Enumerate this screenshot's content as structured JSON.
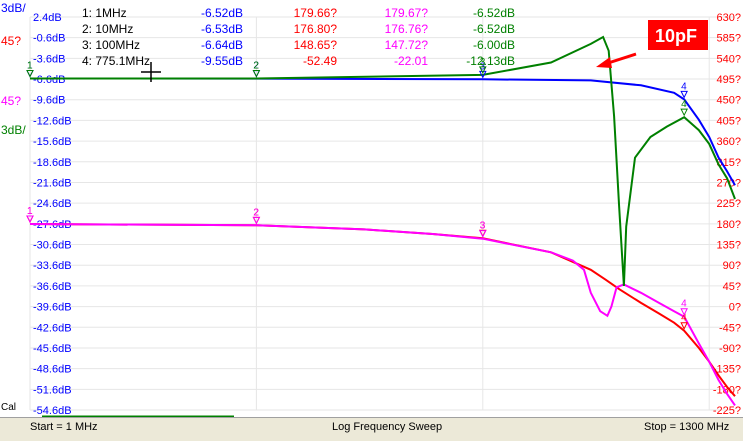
{
  "colors": {
    "trace_s21_mag": "#0000ff",
    "trace_s21_phase": "#ff0000",
    "trace_ref_phase": "#ff00ff",
    "trace_10pf": "#008000",
    "annotation_bg": "#ff0000",
    "arrow": "#ff0000"
  },
  "axis_labels": {
    "blue_scale": "3dB/",
    "red_scale": "45?",
    "magenta_scale": "45?",
    "green_scale": "3dB/"
  },
  "annotation": {
    "label": "10pF"
  },
  "cal_label": "Cal",
  "status": {
    "start": "Start = 1 MHz",
    "mode": "Log Frequency Sweep",
    "stop": "Stop = 1300 MHz"
  },
  "chart_data": {
    "type": "line",
    "x_scale": "log",
    "xlim": [
      1,
      1300
    ],
    "ylim_left": [
      -54.6,
      2.4
    ],
    "ylim_right": [
      -225,
      630
    ],
    "left_ticks": [
      "2.4dB",
      "-0.6dB",
      "-3.6dB",
      "-6.6dB",
      "-9.6dB",
      "-12.6dB",
      "-15.6dB",
      "-18.6dB",
      "-21.6dB",
      "-24.6dB",
      "-27.6dB",
      "-30.6dB",
      "-33.6dB",
      "-36.6dB",
      "-39.6dB",
      "-42.6dB",
      "-45.6dB",
      "-48.6dB",
      "-51.6dB",
      "-54.6dB"
    ],
    "right_ticks": [
      "630?",
      "585?",
      "540?",
      "495?",
      "450?",
      "405?",
      "360?",
      "315?",
      "270?",
      "225?",
      "180?",
      "135?",
      "90?",
      "45?",
      "0?",
      "-45?",
      "-90?",
      "-135?",
      "-180?",
      "-225?"
    ],
    "grid": true,
    "marker_table": [
      {
        "label": "1: 1MHz",
        "blue": "-6.52dB",
        "red": "179.66?",
        "magenta": "179.67?",
        "green": "-6.52dB"
      },
      {
        "label": "2: 10MHz",
        "blue": "-6.53dB",
        "red": "176.80?",
        "magenta": "176.76?",
        "green": "-6.52dB"
      },
      {
        "label": "3: 100MHz",
        "blue": "-6.64dB",
        "red": "148.65?",
        "magenta": "147.72?",
        "green": "-6.00dB"
      },
      {
        "label": "4: 775.1MHz",
        "blue": "-9.55dB",
        "red": "-52.49",
        "magenta": "-22.01",
        "green": "-12.13dB"
      }
    ],
    "series": [
      {
        "color": "#0000ff",
        "axis": "left",
        "points": [
          [
            1,
            -6.52
          ],
          [
            10,
            -6.53
          ],
          [
            100,
            -6.64
          ],
          [
            300,
            -6.8
          ],
          [
            500,
            -7.5
          ],
          [
            700,
            -8.6
          ],
          [
            775.1,
            -9.55
          ],
          [
            900,
            -12.5
          ],
          [
            1000,
            -15
          ],
          [
            1100,
            -18
          ],
          [
            1200,
            -20
          ],
          [
            1300,
            -22
          ]
        ]
      },
      {
        "color": "#ff0000",
        "axis": "right",
        "points": [
          [
            1,
            179.66
          ],
          [
            10,
            176.8
          ],
          [
            30,
            168
          ],
          [
            60,
            158
          ],
          [
            100,
            148.65
          ],
          [
            200,
            118
          ],
          [
            300,
            80
          ],
          [
            350,
            58
          ],
          [
            400,
            38
          ],
          [
            500,
            8
          ],
          [
            600,
            -15
          ],
          [
            700,
            -35
          ],
          [
            775.1,
            -52.49
          ],
          [
            900,
            -90
          ],
          [
            1000,
            -120
          ],
          [
            1100,
            -150
          ],
          [
            1200,
            -175
          ],
          [
            1300,
            -195
          ]
        ]
      },
      {
        "color": "#ff00ff",
        "axis": "right",
        "points": [
          [
            1,
            179.67
          ],
          [
            10,
            176.76
          ],
          [
            30,
            168
          ],
          [
            60,
            158
          ],
          [
            100,
            147.72
          ],
          [
            200,
            118
          ],
          [
            250,
            100
          ],
          [
            280,
            80
          ],
          [
            300,
            30
          ],
          [
            330,
            -10
          ],
          [
            355,
            -20
          ],
          [
            370,
            0
          ],
          [
            390,
            42
          ],
          [
            420,
            48
          ],
          [
            500,
            30
          ],
          [
            600,
            8
          ],
          [
            700,
            -10
          ],
          [
            775.1,
            -22.01
          ],
          [
            900,
            -80
          ],
          [
            1000,
            -120
          ],
          [
            1100,
            -160
          ],
          [
            1200,
            -190
          ],
          [
            1300,
            -215
          ]
        ]
      },
      {
        "color": "#008000",
        "axis": "left",
        "points": [
          [
            1,
            -6.52
          ],
          [
            10,
            -6.52
          ],
          [
            100,
            -6.0
          ],
          [
            200,
            -4.2
          ],
          [
            300,
            -1.5
          ],
          [
            340,
            -0.5
          ],
          [
            360,
            -2.5
          ],
          [
            380,
            -12
          ],
          [
            400,
            -25
          ],
          [
            420,
            -36.6
          ],
          [
            430,
            -28
          ],
          [
            470,
            -18
          ],
          [
            550,
            -15
          ],
          [
            650,
            -13.5
          ],
          [
            775.1,
            -12.13
          ],
          [
            900,
            -14
          ],
          [
            1000,
            -16
          ],
          [
            1100,
            -19
          ],
          [
            1200,
            -21
          ],
          [
            1300,
            -24
          ]
        ]
      }
    ],
    "marker_freqs": [
      1,
      10,
      100,
      775.1
    ]
  }
}
